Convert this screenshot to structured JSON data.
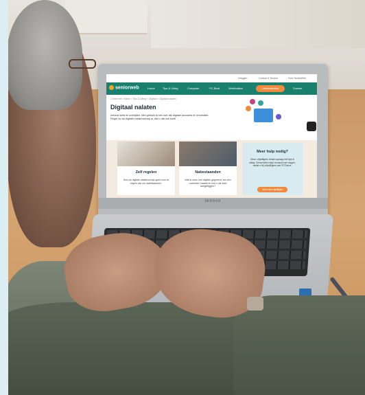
{
  "laptop": {
    "brand": "lenovo"
  },
  "website": {
    "topbar_links": [
      "Inloggen",
      "Contact & Service",
      "Over SeniorWeb"
    ],
    "logo": "seniorweb",
    "nav": [
      "Home",
      "Tips & Uitleg",
      "Computer",
      "PC-Beat",
      "Werkbalken",
      "Lidmaatschap",
      "Zoeken"
    ],
    "breadcrumb": "U bent hier: Home > Tips & Uitleg > Digitaal > Digitaal nalaten",
    "page_title": "Digitaal nalaten",
    "intro": "Iemand kiest te overlijden. Met gebruik al het over die digitale accounts en informatie. Regel nu uw digitale nalatenschap al, dat u dat ook kunt!",
    "cards": [
      {
        "title": "Zelf regelen",
        "text": "Hoe uw digitale nalatenschap goed voor te regeln van uw nabestaanden."
      },
      {
        "title": "Nabestaanden",
        "text": "Wat te doen met digitale gegevens van een overleden naaste en hoe u die kunt aangeleggen?"
      }
    ],
    "help": {
      "title": "Meer hulp nodig?",
      "text": "Deze vrijwilligers helpen graag met tips & uitleg. SeniorWeb helpt iemand met vragen, nadat u bij vrijwilligers van PCDeurs.",
      "button": "Vind een vrijwilliger"
    }
  },
  "colors": {
    "nav_green": "#18806d",
    "accent_orange": "#f08a3c",
    "help_blue": "#d7ebf1"
  }
}
